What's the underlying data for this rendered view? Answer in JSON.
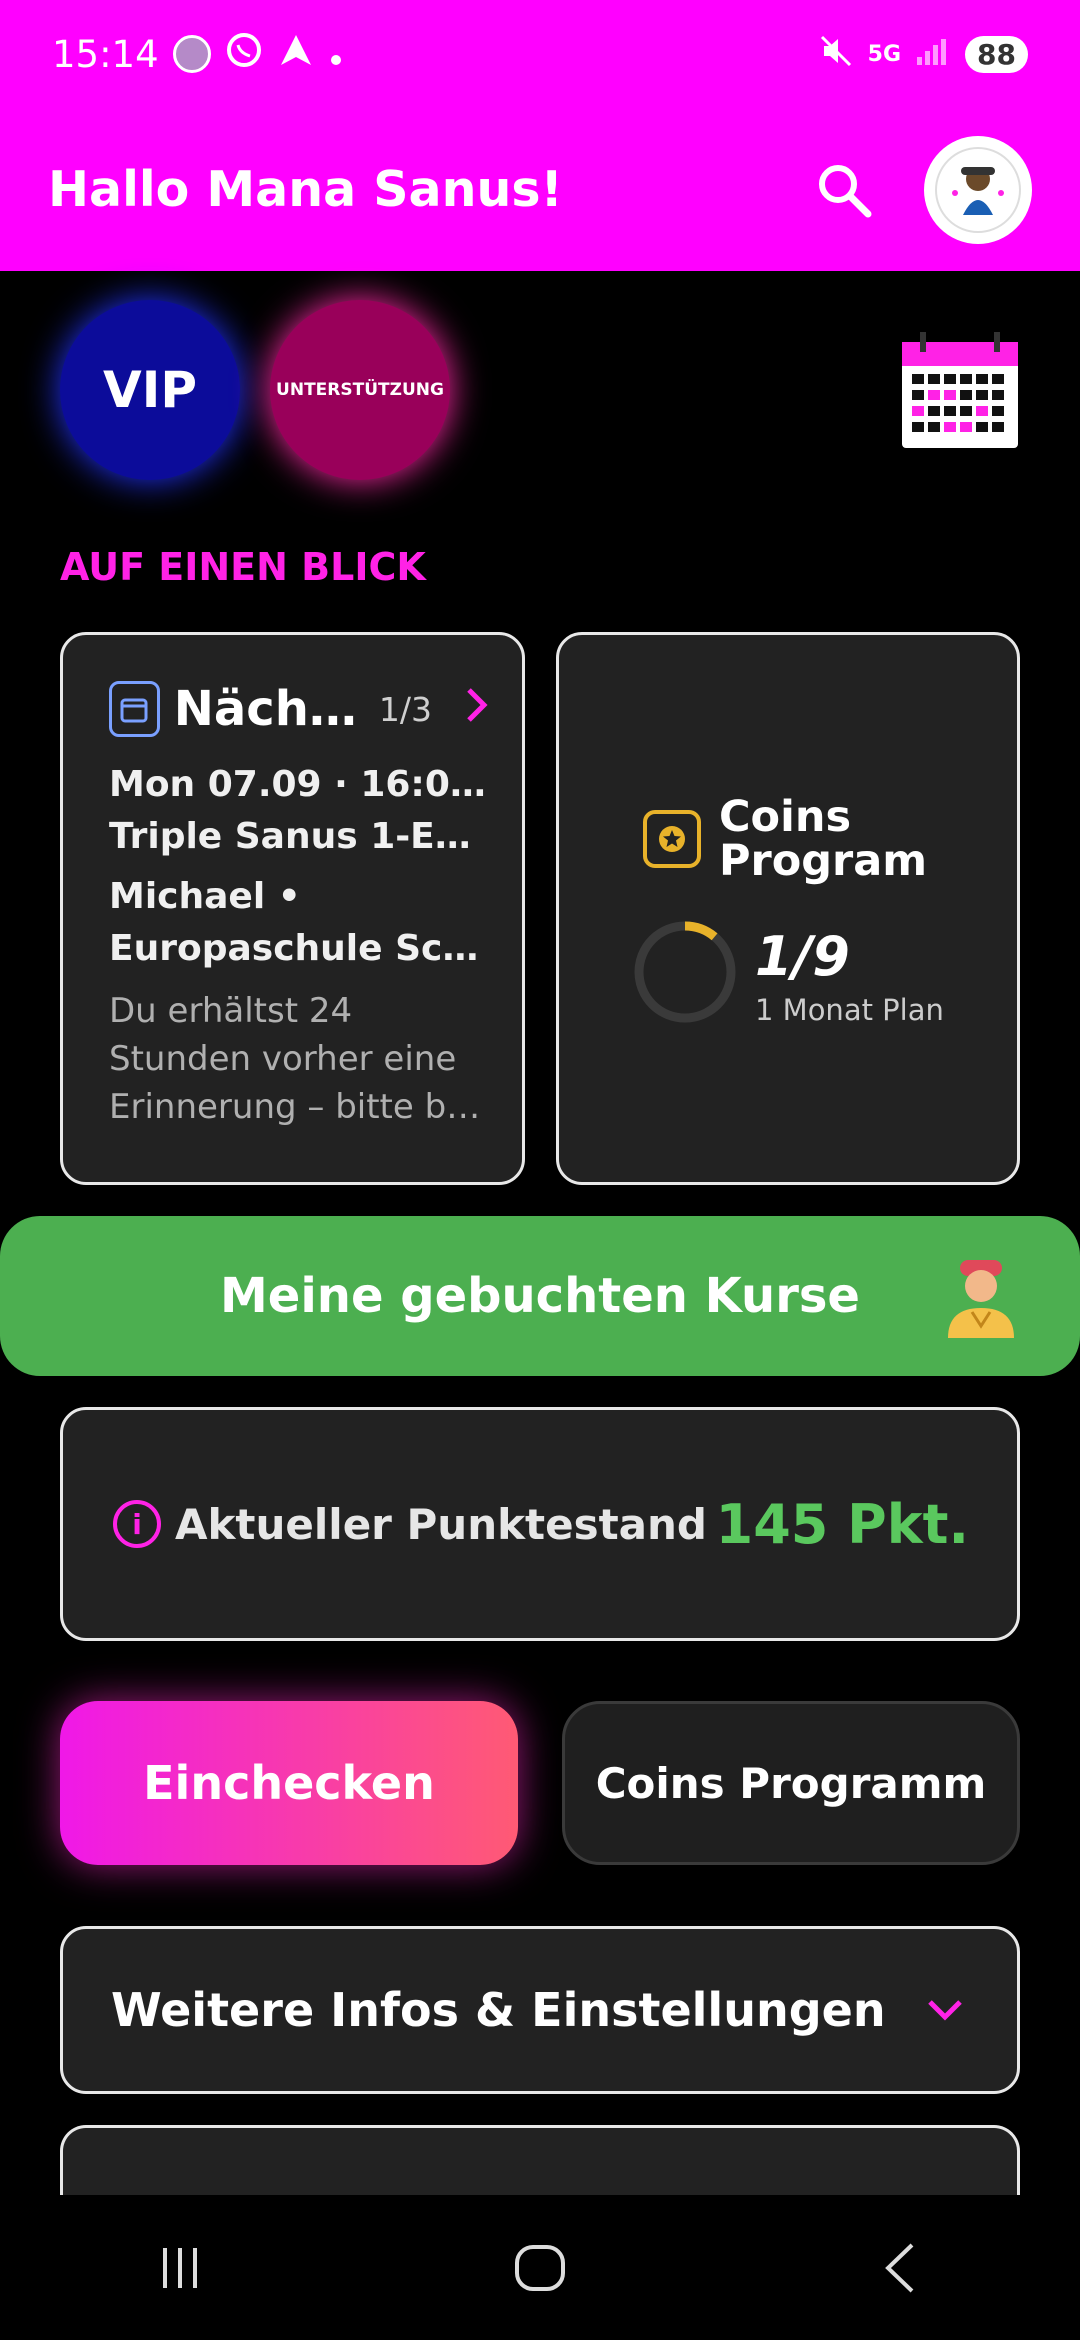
{
  "status_bar": {
    "time": "15:14",
    "network": "5G",
    "battery": "88",
    "icons": [
      "app-icon",
      "whatsapp-icon",
      "arrow-icon",
      "dot-icon",
      "mute-icon",
      "signal-icon"
    ]
  },
  "app_bar": {
    "greeting": "Hallo Mana Sanus!",
    "search_icon": "search-icon",
    "avatar_label": "profile-avatar"
  },
  "quick_buttons": {
    "vip": "VIP",
    "support": "UNTERSTÜTZUNG",
    "calendar_icon": "calendar-icon"
  },
  "section": {
    "title": "AUF EINEN BLICK"
  },
  "next_course": {
    "title": "Näch…",
    "counter": "1/3",
    "line1": "Mon 07.09 · 16:00 ·",
    "line2": "Triple Sanus 1-E1: …",
    "line3": "Michael •",
    "line4": "Europaschule Sc…",
    "note": "Du erhältst 24 Stunden vorher eine Erinnerung – bitte b…"
  },
  "coins_card": {
    "title_line1": "Coins",
    "title_line2": "Program",
    "value": "1/9",
    "plan": "1 Monat Plan",
    "progress": 0.111
  },
  "booked_courses": {
    "label": "Meine gebuchten Kurse"
  },
  "points": {
    "label": "Aktueller Punktestand",
    "value": "145 Pkt."
  },
  "actions": {
    "checkin": "Einchecken",
    "coins_program": "Coins Programm"
  },
  "more": {
    "label": "Weitere Infos & Einstellungen"
  },
  "colors": {
    "brand": "#ff00ff",
    "accent": "#ff22e6",
    "success": "#4caf50",
    "points": "#5ac85e",
    "coin": "#e8b22a"
  }
}
